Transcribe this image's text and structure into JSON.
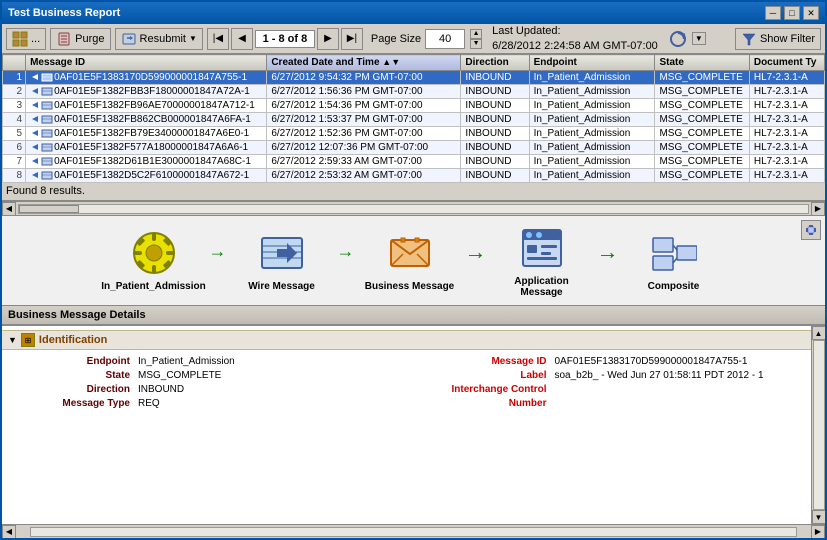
{
  "window": {
    "title": "Test Business Report",
    "controls": [
      "-",
      "□",
      "✕"
    ]
  },
  "toolbar": {
    "grid_icon": "⊞",
    "ellipsis": "...",
    "purge_label": "Purge",
    "resubmit_label": "Resubmit",
    "page_info": "1 - 8 of 8",
    "page_size_label": "Page Size",
    "page_size": "40",
    "last_updated_label": "Last Updated:",
    "last_updated_value": "6/28/2012 2:24:58 AM GMT-07:00",
    "show_filter_label": "Show Filter"
  },
  "table": {
    "columns": [
      "Message ID",
      "Created Date and Time",
      "Direction",
      "Endpoint",
      "State",
      "Document Ty"
    ],
    "rows": [
      {
        "num": "1",
        "selected": true,
        "id": "0AF01E5F1383170D599000001847A755-1",
        "date": "6/27/2012 9:54:32 PM GMT-07:00",
        "direction": "INBOUND",
        "endpoint": "In_Patient_Admission",
        "state": "MSG_COMPLETE",
        "doctype": "HL7-2.3.1-A"
      },
      {
        "num": "2",
        "selected": false,
        "id": "0AF01E5F1382FBB3F18000001847A72A-1",
        "date": "6/27/2012 1:56:36 PM GMT-07:00",
        "direction": "INBOUND",
        "endpoint": "In_Patient_Admission",
        "state": "MSG_COMPLETE",
        "doctype": "HL7-2.3.1-A"
      },
      {
        "num": "3",
        "selected": false,
        "id": "0AF01E5F1382FB96AE70000001847A712-1",
        "date": "6/27/2012 1:54:36 PM GMT-07:00",
        "direction": "INBOUND",
        "endpoint": "In_Patient_Admission",
        "state": "MSG_COMPLETE",
        "doctype": "HL7-2.3.1-A"
      },
      {
        "num": "4",
        "selected": false,
        "id": "0AF01E5F1382FB862CB000001847A6FA-1",
        "date": "6/27/2012 1:53:37 PM GMT-07:00",
        "direction": "INBOUND",
        "endpoint": "In_Patient_Admission",
        "state": "MSG_COMPLETE",
        "doctype": "HL7-2.3.1-A"
      },
      {
        "num": "5",
        "selected": false,
        "id": "0AF01E5F1382FB79E34000001847A6E0-1",
        "date": "6/27/2012 1:52:36 PM GMT-07:00",
        "direction": "INBOUND",
        "endpoint": "In_Patient_Admission",
        "state": "MSG_COMPLETE",
        "doctype": "HL7-2.3.1-A"
      },
      {
        "num": "6",
        "selected": false,
        "id": "0AF01E5F1382F577A18000001847A6A6-1",
        "date": "6/27/2012 12:07:36 PM GMT-07:00",
        "direction": "INBOUND",
        "endpoint": "In_Patient_Admission",
        "state": "MSG_COMPLETE",
        "doctype": "HL7-2.3.1-A"
      },
      {
        "num": "7",
        "selected": false,
        "id": "0AF01E5F1382D61B1E3000001847A68C-1",
        "date": "6/27/2012 2:59:33 AM GMT-07:00",
        "direction": "INBOUND",
        "endpoint": "In_Patient_Admission",
        "state": "MSG_COMPLETE",
        "doctype": "HL7-2.3.1-A"
      },
      {
        "num": "8",
        "selected": false,
        "id": "0AF01E5F1382D5C2F61000001847A672-1",
        "date": "6/27/2012 2:53:32 AM GMT-07:00",
        "direction": "INBOUND",
        "endpoint": "In_Patient_Admission",
        "state": "MSG_COMPLETE",
        "doctype": "HL7-2.3.1-A"
      }
    ],
    "found": "Found 8 results."
  },
  "flow": {
    "items": [
      {
        "id": "in-patient",
        "label": "In_Patient_Admission",
        "icon": "gear"
      },
      {
        "id": "wire-msg",
        "label": "Wire Message",
        "icon": "wire"
      },
      {
        "id": "business-msg",
        "label": "Business Message",
        "icon": "business"
      },
      {
        "id": "app-msg",
        "label": "Application Message",
        "icon": "app"
      },
      {
        "id": "composite",
        "label": "Composite",
        "icon": "composite"
      }
    ]
  },
  "details": {
    "header": "Business Message Details",
    "section_title": "Identification",
    "fields": {
      "endpoint_label": "Endpoint",
      "endpoint_value": "In_Patient_Admission",
      "state_label": "State",
      "state_value": "MSG_COMPLETE",
      "direction_label": "Direction",
      "direction_value": "INBOUND",
      "message_type_label": "Message Type",
      "message_type_value": "REQ",
      "message_id_label": "Message ID",
      "message_id_value": "0AF01E5F1383170D599000001847A755-1",
      "label_label": "Label",
      "label_value": "soa_b2b_ - Wed Jun 27 01:58:11 PDT 2012 - 1",
      "interchange_label": "Interchange Control",
      "interchange_label2": "Number",
      "interchange_value": ""
    }
  },
  "colors": {
    "selected_row_bg": "#316ac5",
    "header_gradient_start": "#1a6dc0",
    "header_gradient_end": "#0054a6",
    "section_header_bg": "#e8e4dc",
    "flow_arrow": "#008000",
    "label_color": "#600000"
  }
}
